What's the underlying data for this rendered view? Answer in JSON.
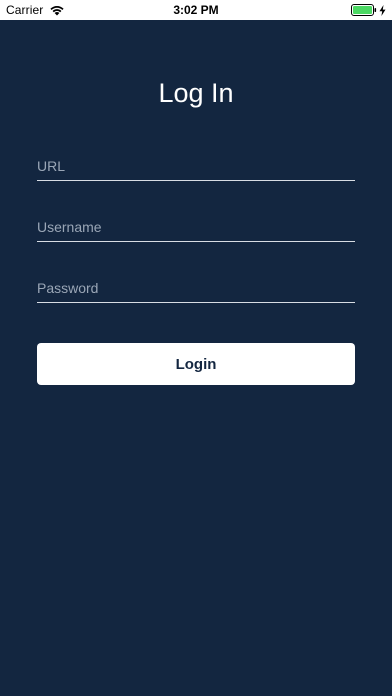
{
  "status_bar": {
    "carrier": "Carrier",
    "time": "3:02 PM",
    "icons": {
      "wifi": "wifi-icon",
      "battery": "battery-icon",
      "charging": "bolt-icon"
    },
    "battery_color": "#4cd964"
  },
  "login": {
    "title": "Log In",
    "url_placeholder": "URL",
    "url_value": "",
    "username_placeholder": "Username",
    "username_value": "",
    "password_placeholder": "Password",
    "password_value": "",
    "button_label": "Login"
  },
  "colors": {
    "background": "#132640",
    "field_underline": "#d8dde4",
    "placeholder": "#9aa6b6",
    "button_bg": "#ffffff",
    "button_text": "#132640"
  }
}
